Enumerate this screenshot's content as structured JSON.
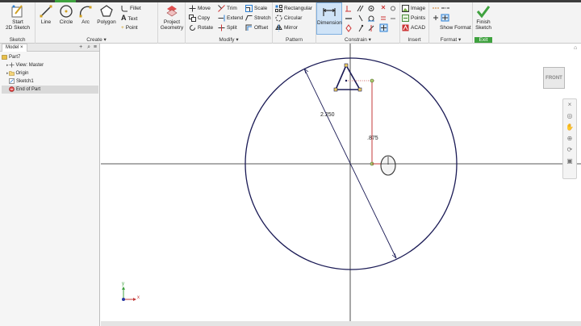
{
  "ribbon": {
    "sketch_group": {
      "label": "Sketch",
      "start_2d": "Start\n2D Sketch"
    },
    "create_group": {
      "label": "Create",
      "line": "Line",
      "circle": "Circle",
      "arc": "Arc",
      "polygon": "Polygon",
      "fillet": "Fillet",
      "text": "Text",
      "point": "Point"
    },
    "project_geometry": "Project\nGeometry",
    "modify_group": {
      "label": "Modify",
      "move": "Move",
      "copy": "Copy",
      "rotate": "Rotate",
      "trim": "Trim",
      "extend": "Extend",
      "split": "Split",
      "scale": "Scale",
      "stretch": "Stretch",
      "offset": "Offset"
    },
    "pattern_group": {
      "label": "Pattern",
      "rectangular": "Rectangular",
      "circular": "Circular",
      "mirror": "Mirror"
    },
    "constrain_group": {
      "label": "Constrain",
      "dimension": "Dimension"
    },
    "insert_group": {
      "label": "Insert",
      "image": "Image",
      "points": "Points",
      "acad": "ACAD"
    },
    "format_group": {
      "label": "Format",
      "show_format": "Show Format"
    },
    "exit_group": {
      "label": "Exit",
      "finish_sketch": "Finish\nSketch"
    }
  },
  "browser": {
    "tab": "Model",
    "add_symbol": "+",
    "search_symbol": "⌕",
    "menu_symbol": "≡",
    "items": [
      {
        "label": "Part7"
      },
      {
        "label": "View: Master"
      },
      {
        "label": "Origin"
      },
      {
        "label": "Sketch1"
      },
      {
        "label": "End of Part"
      }
    ]
  },
  "canvas": {
    "dimension_diameter": "2.250",
    "dimension_vertical": ".875",
    "viewcube_label": "FRONT",
    "axis_x_label": "x",
    "axis_y_label": "y"
  },
  "colors": {
    "geometry": "#1a1a55",
    "dimension": "#c43a3a",
    "accent": "#2a7fd4",
    "finish_green": "#3fa23f"
  }
}
